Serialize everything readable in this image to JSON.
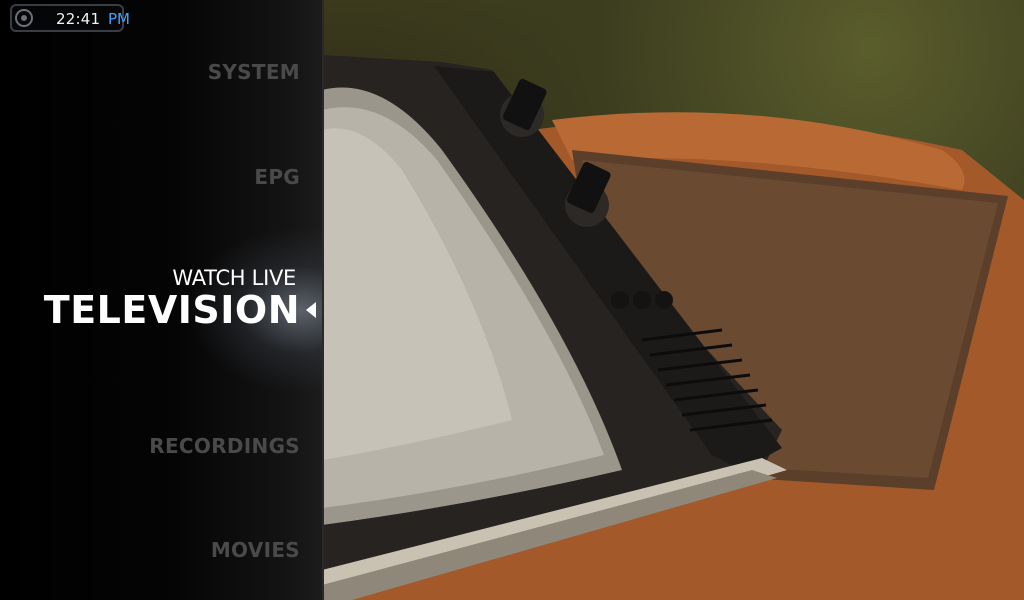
{
  "clock": {
    "time": "22:41",
    "ampm": "PM",
    "icon": "power-icon"
  },
  "menu": {
    "items": [
      {
        "label": "SYSTEM"
      },
      {
        "label": "EPG"
      },
      {
        "label": "RECORDINGS"
      },
      {
        "label": "MOVIES"
      }
    ],
    "active": {
      "subtitle": "WATCH LIVE",
      "label": "TELEVISION"
    }
  },
  "colors": {
    "accent": "#3fa4ff",
    "active_text": "#ffffff",
    "inactive_text": "#4a4a4a",
    "panel_bg": "#000000"
  },
  "backdrop": {
    "icon": "retro-tv-image"
  }
}
